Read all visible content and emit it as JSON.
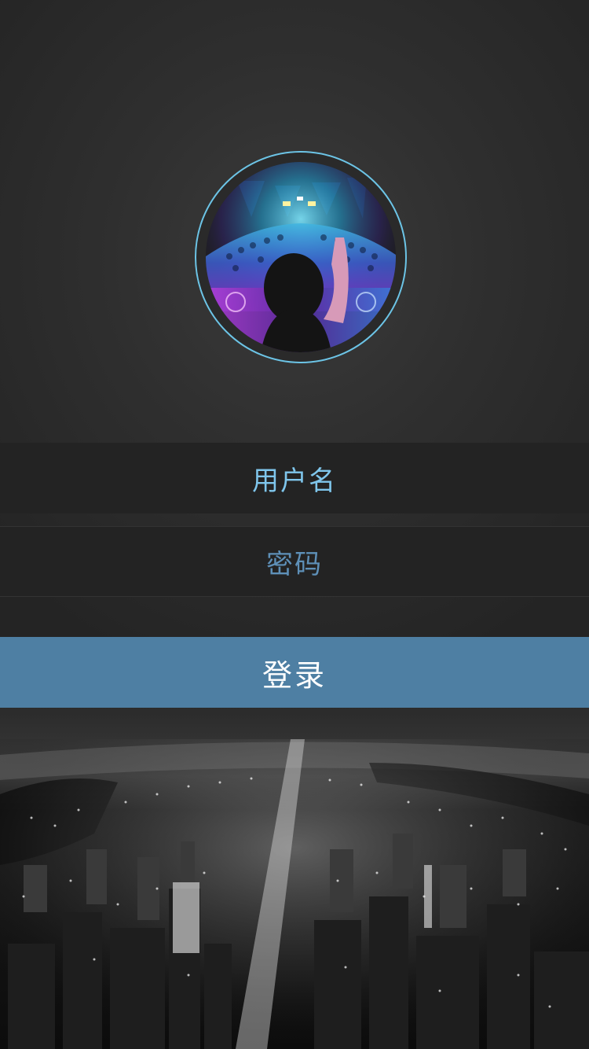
{
  "login_form": {
    "username_placeholder": "用户名",
    "password_placeholder": "密码",
    "login_label": "登录"
  },
  "colors": {
    "background": "#2d2d2d",
    "field_background": "#232323",
    "username_text": "#7fc6ec",
    "password_text": "#5e90b8",
    "login_button": "#4e7fa3",
    "avatar_ring": "#6cc4e6"
  },
  "icons": {
    "avatar": "dj-concert-avatar",
    "background": "night-city-aerial"
  }
}
